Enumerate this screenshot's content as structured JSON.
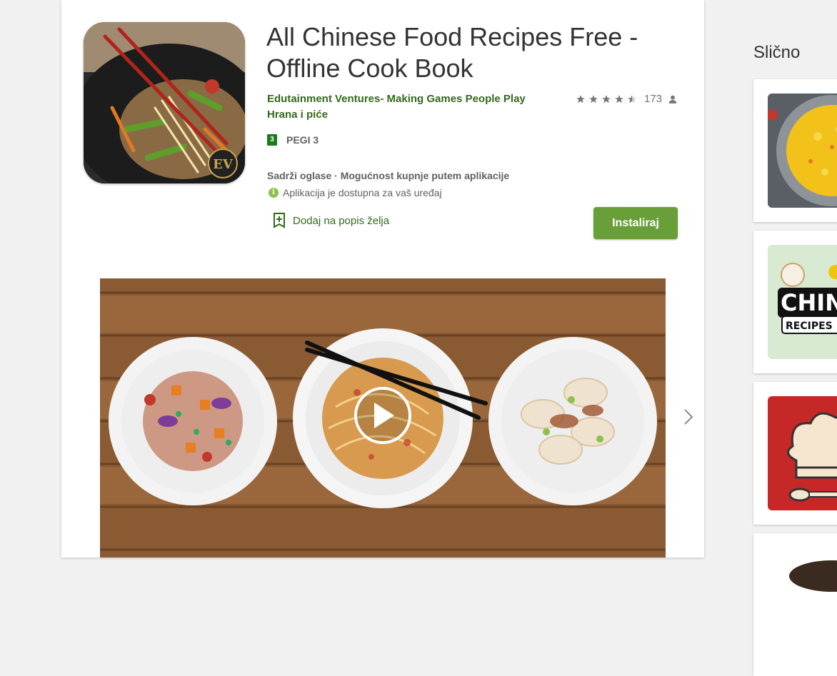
{
  "app": {
    "title": "All Chinese Food Recipes Free - Offline Cook Book",
    "developer": "Edutainment Ventures- Making Games People Play",
    "category": "Hrana i piće",
    "rating": {
      "stars": 4.5,
      "count": "173"
    },
    "content_rating": {
      "icon_text": "3",
      "label": "PEGI 3"
    },
    "ads_notice": "Sadrži oglase · Mogućnost kupnje putem aplikacije",
    "availability": "Aplikacija je dostupna za vaš uređaj",
    "wishlist_label": "Dodaj na popis želja",
    "install_label": "Instaliraj",
    "icon_badge": "EV"
  },
  "similar": {
    "heading": "Slično",
    "items": [
      {
        "icon": "rice-dish-thumbnail"
      },
      {
        "icon": "chinese-recipes-logo-thumbnail",
        "text_line1": "CHINE",
        "text_line2": "RECIPES"
      },
      {
        "icon": "chef-hat-thumbnail"
      },
      {
        "icon": "dish-thumbnail"
      }
    ]
  },
  "colors": {
    "accent_green": "#689f38",
    "link_green": "#33691e",
    "text_dark": "#333333",
    "text_grey": "#616161"
  }
}
